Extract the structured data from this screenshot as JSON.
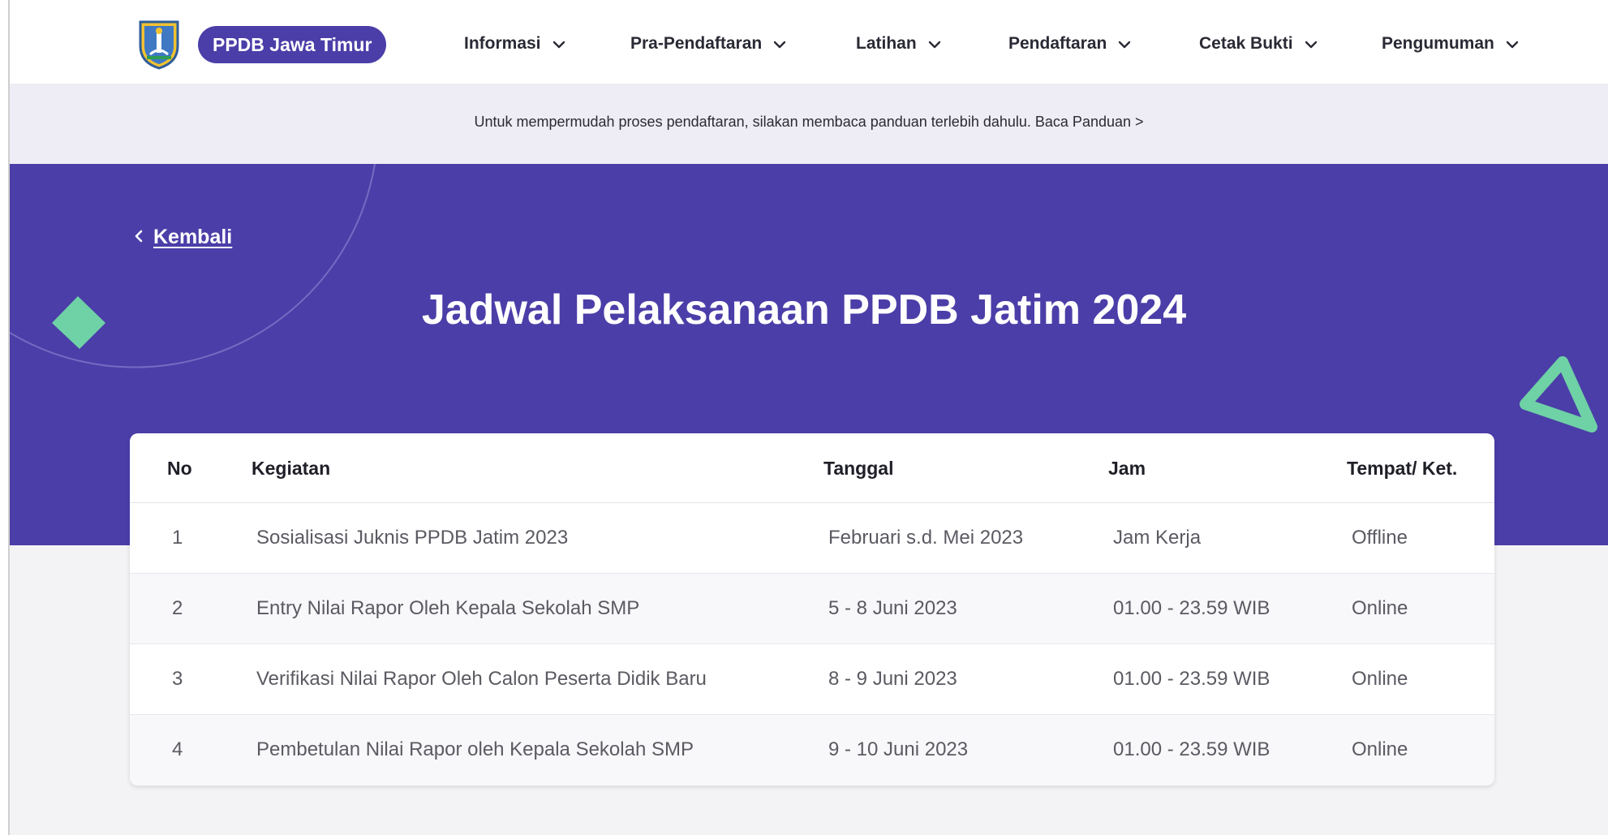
{
  "brand": {
    "name": "PPDB Jawa Timur"
  },
  "nav": {
    "items": [
      {
        "label": "Informasi"
      },
      {
        "label": "Pra-Pendaftaran"
      },
      {
        "label": "Latihan"
      },
      {
        "label": "Pendaftaran"
      },
      {
        "label": "Cetak Bukti"
      },
      {
        "label": "Pengumuman"
      }
    ]
  },
  "info": {
    "text": "Untuk mempermudah proses pendaftaran, silakan membaca panduan terlebih dahulu.",
    "link": "Baca Panduan >"
  },
  "back": {
    "label": "Kembali"
  },
  "page": {
    "title": "Jadwal Pelaksanaan PPDB Jatim 2024"
  },
  "table": {
    "headers": [
      "No",
      "Kegiatan",
      "Tanggal",
      "Jam",
      "Tempat/ Ket."
    ],
    "rows": [
      [
        "1",
        "Sosialisasi Juknis PPDB Jatim 2023",
        "Februari s.d. Mei 2023",
        "Jam Kerja",
        "Offline"
      ],
      [
        "2",
        "Entry Nilai Rapor Oleh Kepala Sekolah SMP",
        "5 - 8 Juni 2023",
        "01.00 - 23.59 WIB",
        "Online"
      ],
      [
        "3",
        "Verifikasi Nilai Rapor Oleh Calon Peserta Didik Baru",
        "8 - 9 Juni 2023",
        "01.00 - 23.59 WIB",
        "Online"
      ],
      [
        "4",
        "Pembetulan Nilai Rapor oleh Kepala Sekolah SMP",
        "9 - 10 Juni 2023",
        "01.00 - 23.59 WIB",
        "Online"
      ]
    ]
  },
  "colors": {
    "brand": "#4b3ea8",
    "accent_shape": "#6fd1a6",
    "info_bg": "#eeedf5"
  },
  "icons": {
    "logo": "east-java-emblem",
    "nav_chevron": "chevron-down-icon",
    "back": "chevron-left-icon"
  }
}
